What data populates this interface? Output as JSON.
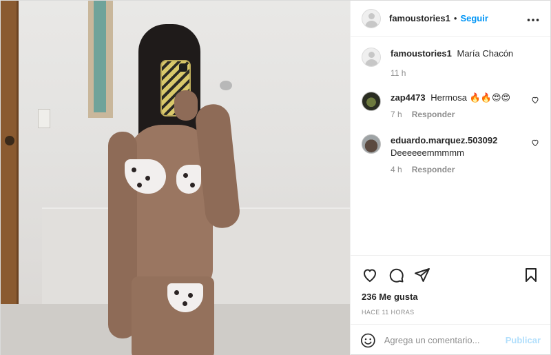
{
  "header": {
    "username": "famoustories1",
    "separator": "•",
    "follow_label": "Seguir",
    "more_icon": "more-horizontal-icon"
  },
  "caption": {
    "username": "famoustories1",
    "text": "María Chacón",
    "time": "11 h"
  },
  "comments": [
    {
      "username": "zap4473",
      "text": "Hermosa 🔥🔥😍😍",
      "time": "7 h",
      "reply_label": "Responder"
    },
    {
      "username": "eduardo.marquez.503092",
      "text": "Deeeeeemmmmm",
      "time": "4 h",
      "reply_label": "Responder"
    }
  ],
  "actions": {
    "icons": [
      "heart-icon",
      "comment-icon",
      "share-icon",
      "bookmark-icon"
    ],
    "likes": "236 Me gusta",
    "timestamp": "HACE 11 HORAS"
  },
  "composer": {
    "placeholder": "Agrega un comentario...",
    "post_label": "Publicar"
  },
  "colors": {
    "accent": "#0095f6",
    "post_disabled": "#b2dffc",
    "text": "#262626",
    "muted": "#8e8e8e",
    "border": "#efefef"
  }
}
